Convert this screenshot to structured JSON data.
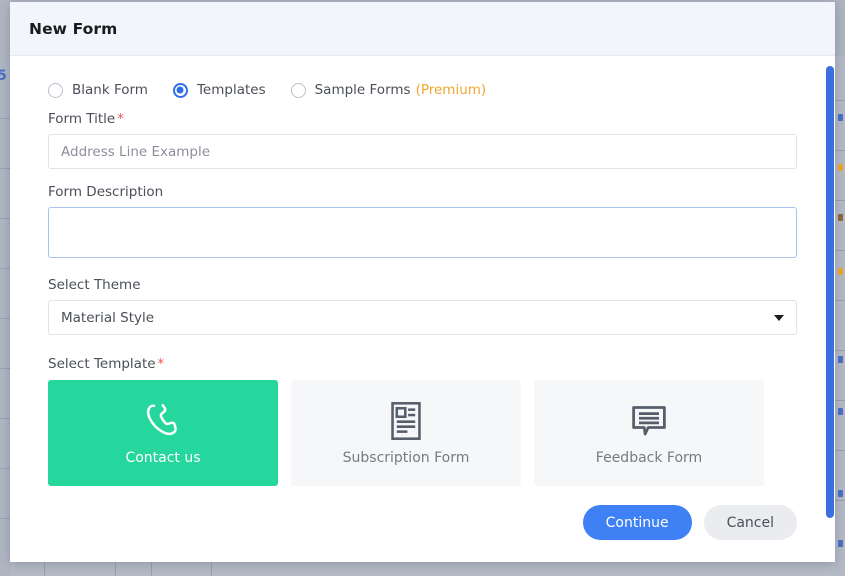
{
  "modal": {
    "title": "New Form",
    "form_type": {
      "options": [
        {
          "label": "Blank Form",
          "selected": false,
          "icon": "radio-unchecked-icon"
        },
        {
          "label": "Templates",
          "selected": true,
          "icon": "radio-checked-icon"
        },
        {
          "label": "Sample Forms",
          "selected": false,
          "icon": "radio-unchecked-icon",
          "badge": "(Premium)"
        }
      ]
    },
    "fields": {
      "form_title": {
        "label": "Form Title",
        "required_marker": "*",
        "value": "",
        "placeholder": "Address Line Example"
      },
      "form_description": {
        "label": "Form Description",
        "required_marker": "",
        "value": "",
        "placeholder": "",
        "focused": true
      },
      "select_theme": {
        "label": "Select Theme",
        "required_marker": "",
        "value": "Material Style",
        "caret_icon": "chevron-down-icon"
      },
      "select_template": {
        "label": "Select Template",
        "required_marker": "*"
      }
    },
    "templates": [
      {
        "label": "Contact us",
        "icon": "phone-icon",
        "selected": true
      },
      {
        "label": "Subscription Form",
        "icon": "article-icon",
        "selected": false
      },
      {
        "label": "Feedback Form",
        "icon": "speech-bubble-icon",
        "selected": false
      }
    ],
    "footer": {
      "continue_label": "Continue",
      "cancel_label": "Cancel"
    }
  },
  "colors": {
    "header_bg": "#f2f5fc",
    "accent_blue": "#4080f5",
    "selected_green": "#26d79d",
    "premium_orange": "#efa62e",
    "required_red": "#f0544c",
    "scrollbar_blue": "#3b6fe0"
  },
  "backdrop": {
    "left_glyph": "5",
    "scrollbar": "vertical-scrollbar"
  }
}
